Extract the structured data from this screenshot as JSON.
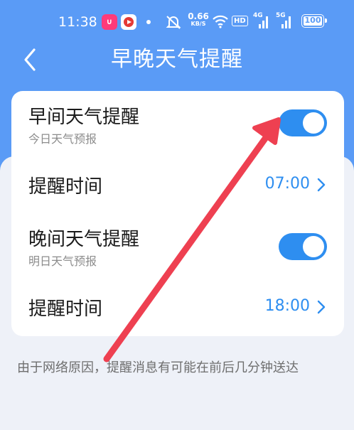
{
  "status_bar": {
    "time": "11:38",
    "net_speed_value": "0.66",
    "net_speed_unit": "KB/S",
    "hd_label": "HD",
    "signal1_label": "4G",
    "signal2_label": "5G",
    "battery": "100"
  },
  "header": {
    "title": "早晚天气提醒"
  },
  "settings": {
    "morning": {
      "title": "早间天气提醒",
      "subtitle": "今日天气预报",
      "enabled": true
    },
    "morning_time": {
      "label": "提醒时间",
      "value": "07:00"
    },
    "evening": {
      "title": "晚间天气提醒",
      "subtitle": "明日天气预报",
      "enabled": true
    },
    "evening_time": {
      "label": "提醒时间",
      "value": "18:00"
    }
  },
  "note": "由于网络原因，提醒消息有可能在前后几分钟送达",
  "colors": {
    "header_blue": "#5a9bf6",
    "toggle_on": "#2e8ef0",
    "annotation_arrow": "#ee4051"
  }
}
